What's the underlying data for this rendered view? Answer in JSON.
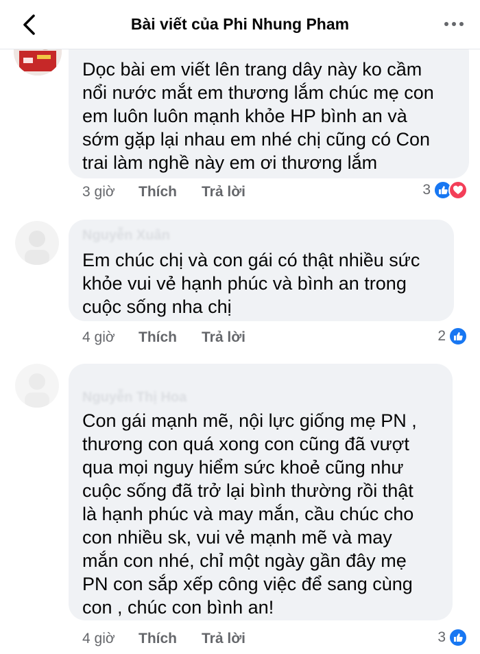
{
  "header": {
    "title": "Bài viết của Phi Nhung Pham"
  },
  "comments": [
    {
      "author": "",
      "text": "Dọc bài em viết lên trang dây này ko cầm\nnổi nước mắt em thương lắm chúc mẹ con\nem luôn luôn mạnh khỏe HP bình an và\nsớm gặp lại nhau em nhé chị cũng có Con\ntrai làm nghề này em ơi thương lắm",
      "time": "3 giờ",
      "like_label": "Thích",
      "reply_label": "Trả lời",
      "reaction_count": "3",
      "reactions": [
        "like-icon",
        "love-icon"
      ]
    },
    {
      "author": "Nguyễn Xuân",
      "text": "Em chúc chị và con gái có thật nhiều sức\nkhỏe vui vẻ hạnh phúc và bình an trong\ncuộc sống nha chị",
      "time": "4 giờ",
      "like_label": "Thích",
      "reply_label": "Trả lời",
      "reaction_count": "2",
      "reactions": [
        "like-icon"
      ]
    },
    {
      "author": "Nguyễn Thị Hoa",
      "text": "Con gái mạnh mẽ, nội lực giống mẹ PN ,\nthương con quá xong con cũng đã vượt\nqua mọi nguy hiểm sức khoẻ cũng như\ncuộc sống đã trở lại bình thường rồi thật\nlà hạnh phúc và may mắn, cầu chúc cho\ncon nhiều sk, vui vẻ mạnh mẽ và may\nmắn con nhé, chỉ một ngày gần đây mẹ\nPN con sắp xếp công việc để sang cùng\ncon , chúc con bình an!",
      "time": "4 giờ",
      "like_label": "Thích",
      "reply_label": "Trả lời",
      "reaction_count": "3",
      "reactions": [
        "like-icon"
      ]
    }
  ],
  "colors": {
    "bubble": "#f0f2f5",
    "meta_text": "#65676b",
    "like_blue": "#1877f2",
    "love_red": "#f33e58"
  }
}
